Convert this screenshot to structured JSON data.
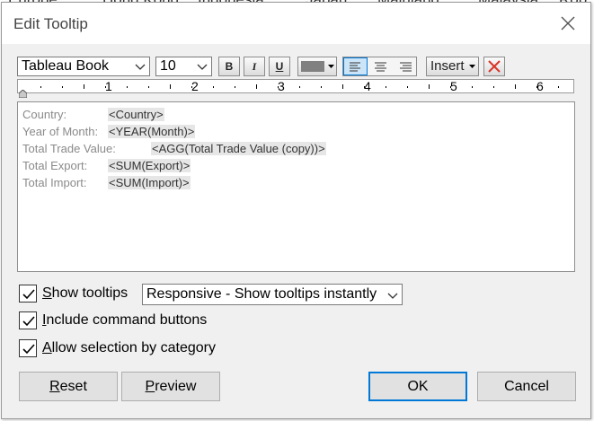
{
  "background_labels": [
    "Europe",
    "Hong Kong",
    "Indonesia",
    "Japan",
    "Mainland",
    "Malaysia",
    "Rob"
  ],
  "dialog": {
    "title": "Edit Tooltip"
  },
  "toolbar": {
    "font_family": "Tableau Book",
    "font_size": "10",
    "bold_label": "B",
    "italic_label": "I",
    "underline_label": "U",
    "insert_label": "Insert",
    "font_color": "#808080"
  },
  "ruler": {
    "marks": [
      "1",
      "2",
      "3",
      "4",
      "5",
      "6"
    ]
  },
  "editor": {
    "rows": [
      {
        "label": "Country:",
        "field": "<Country>"
      },
      {
        "label": "Year of Month:",
        "field": "<YEAR(Month)>"
      },
      {
        "label": "Total Trade Value:",
        "field": "<AGG(Total Trade Value (copy))>"
      },
      {
        "label": "Total Export:",
        "field": "<SUM(Export)>"
      },
      {
        "label": "Total Import:",
        "field": "<SUM(Import)>"
      }
    ]
  },
  "options": {
    "show_tooltips": {
      "label_u": "S",
      "label_rest": "how tooltips",
      "checked": true
    },
    "tooltip_mode": "Responsive - Show tooltips instantly",
    "include_command_buttons": {
      "label_u": "I",
      "label_rest": "nclude command buttons",
      "checked": true
    },
    "allow_selection": {
      "label_u": "A",
      "label_rest": "llow selection by category",
      "checked": true
    }
  },
  "buttons": {
    "reset_u": "R",
    "reset_rest": "eset",
    "preview_u": "P",
    "preview_rest": "review",
    "ok": "OK",
    "cancel": "Cancel"
  },
  "colors": {
    "accent": "#0078d7",
    "close_x": "#d9362a"
  }
}
